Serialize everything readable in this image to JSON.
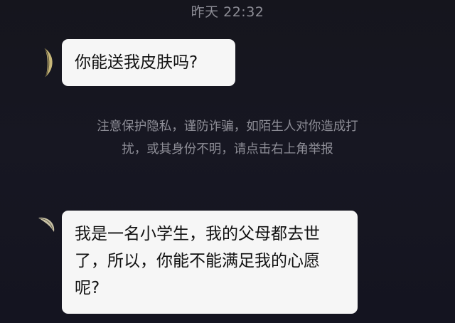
{
  "chat": {
    "timestamp": "昨天 22:32",
    "messages": [
      {
        "sender": "other",
        "avatar_icon": "crescent-avatar-icon",
        "text": "你能送我皮肤吗?"
      },
      {
        "sender": "other",
        "avatar_icon": "crescent-avatar-icon",
        "text": "我是一名小学生，我的父母都去世了，所以，你能不能满足我的心愿呢?"
      }
    ],
    "privacy_notice": "注意保护隐私，谨防诈骗，如陌生人对你造成打扰，或其身份不明，请点击右上角举报"
  },
  "colors": {
    "background": "#16161f",
    "bubble": "#f6f6f6",
    "meta_text": "#8e8e97"
  }
}
